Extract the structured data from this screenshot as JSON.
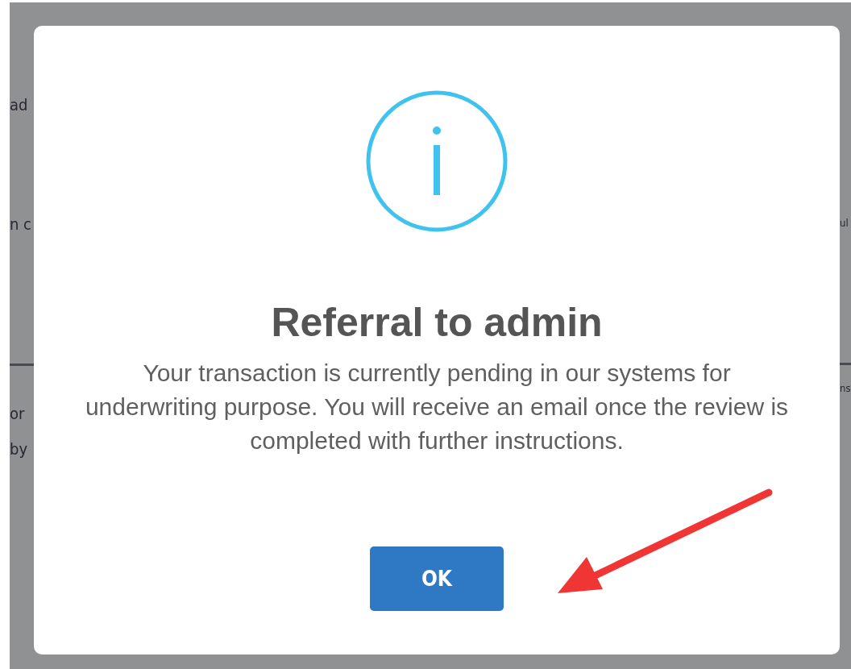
{
  "background": {
    "left_fragments": [
      {
        "text": "ad",
        "kind": "text"
      },
      {
        "text": "n c",
        "kind": "text"
      },
      {
        "kind": "rule"
      },
      {
        "text": "or",
        "kind": "text"
      },
      {
        "text": "by",
        "kind": "text"
      }
    ],
    "right_fragments": [
      {
        "text": "ul",
        "kind": "text"
      },
      {
        "kind": "rule"
      },
      {
        "text": "ns",
        "kind": "text"
      }
    ]
  },
  "dialog": {
    "title": "Referral to admin",
    "message": "Your transaction is currently pending in our systems for underwriting purpose. You will receive an email once the review is completed with further instructions.",
    "button": "OK"
  }
}
